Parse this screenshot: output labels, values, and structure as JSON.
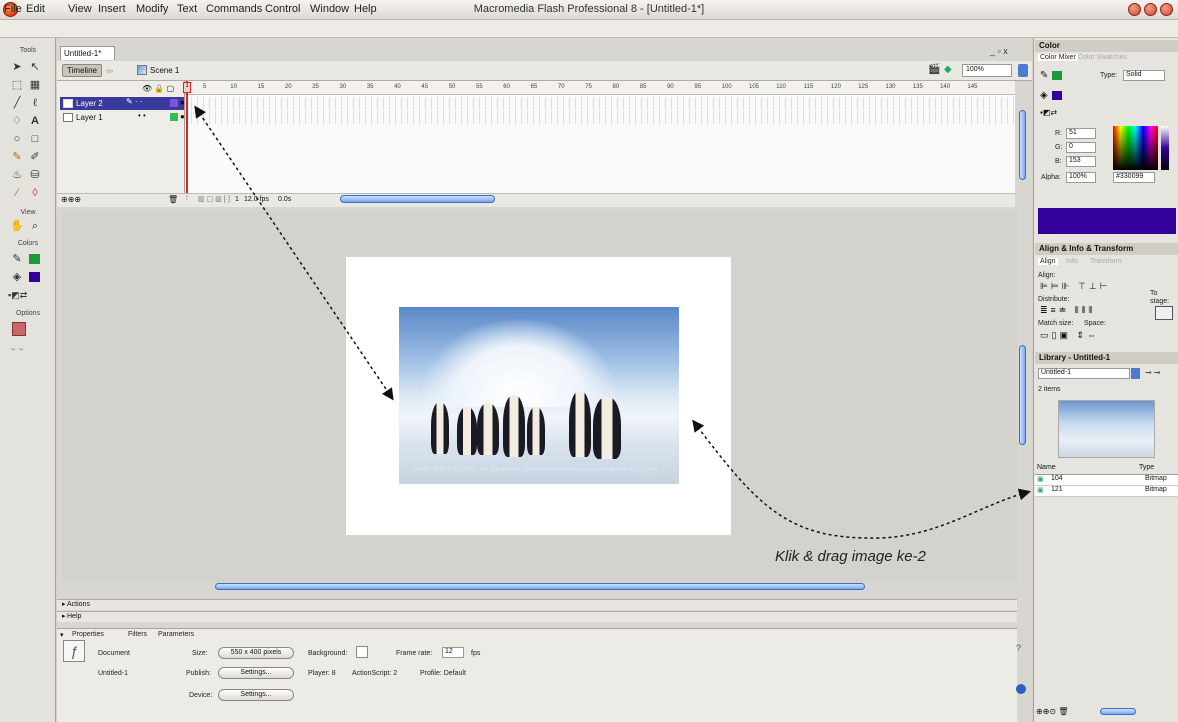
{
  "window": {
    "title": "Macromedia Flash Professional 8 - [Untitled-1*]"
  },
  "menu": [
    "File",
    "Edit",
    "View",
    "Insert",
    "Modify",
    "Text",
    "Commands",
    "Control",
    "Window",
    "Help"
  ],
  "tools": {
    "tools_label": "Tools",
    "view_label": "View",
    "colors_label": "Colors",
    "options_label": "Options"
  },
  "document": {
    "tab_title": "Untitled-1*",
    "window_controls": "_ ▫ x"
  },
  "timeline": {
    "tab_label": "Timeline",
    "scene": "Scene 1",
    "zoom": "100%",
    "frame_numbers": [
      "1",
      "5",
      "10",
      "15",
      "20",
      "25",
      "30",
      "35",
      "40",
      "45",
      "50",
      "55",
      "60",
      "65",
      "70",
      "75",
      "80",
      "85",
      "90",
      "95",
      "100",
      "105",
      "110",
      "115",
      "120",
      "125",
      "130",
      "135",
      "140",
      "145"
    ],
    "layers": [
      {
        "name": "Layer 2"
      },
      {
        "name": "Layer 1"
      }
    ],
    "current_frame": "1",
    "fps": "12.0 fps",
    "time": "0.0s"
  },
  "picture": {
    "caption": "WWF - Fritz POLKING - Per piacere dai ritmo dall'animazione per nascondere le zone grigie ..."
  },
  "panels": {
    "actions": "Actions",
    "help": "Help"
  },
  "properties": {
    "tabs": [
      "Properties",
      "Filters",
      "Parameters"
    ],
    "doc_type": "Document",
    "doc_name": "Untitled-1",
    "size_label": "Size:",
    "size_value": "550 x 400 pixels",
    "background_label": "Background:",
    "frame_rate_label": "Frame rate:",
    "frame_rate_value": "12",
    "fps_label": "fps",
    "publish_label": "Publish:",
    "settings_label": "Settings...",
    "player_text": "Player: 8",
    "actionscript_text": "ActionScript: 2",
    "profile_text": "Profile: Default",
    "device_label": "Device:"
  },
  "color_panel": {
    "title": "Color",
    "tab_mixer": "Color Mixer",
    "tab_swatches": "Color Swatches",
    "type_label": "Type:",
    "type_value": "Solid",
    "r_label": "R:",
    "r_value": "51",
    "g_label": "G:",
    "g_value": "0",
    "b_label": "B:",
    "b_value": "153",
    "alpha_label": "Alpha:",
    "alpha_value": "100%",
    "hex_value": "#330099",
    "swatch_color": "#330099"
  },
  "align_panel": {
    "title": "Align & Info & Transform",
    "tabs": [
      "Align",
      "Info",
      "Transform"
    ],
    "align_label": "Align:",
    "distribute_label": "Distribute:",
    "match_label": "Match size:",
    "space_label": "Space:",
    "to_stage": "To stage:"
  },
  "library": {
    "title": "Library - Untitled-1",
    "doc_select": "Untitled-1",
    "count": "2 items",
    "col_name": "Name",
    "col_type": "Type",
    "items": [
      {
        "name": "104",
        "type": "Bitmap"
      },
      {
        "name": "121",
        "type": "Bitmap"
      }
    ]
  },
  "annotation": "Klik & drag image ke-2"
}
